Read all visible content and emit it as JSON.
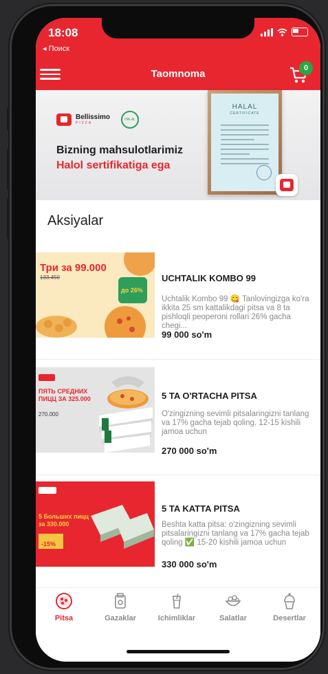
{
  "status_bar": {
    "time": "18:08",
    "back_label": "◂ Поиск"
  },
  "header": {
    "title": "Taomnoma",
    "cart_count": "0"
  },
  "banner": {
    "brand_name": "Bellissimo",
    "brand_sub": "PIZZA",
    "halal_badge": "HALAL",
    "line1": "Bizning mahsulotlarimiz",
    "line2": "Halol sertifikatiga ega",
    "certificate_title": "HALAL",
    "certificate_sub": "CERTIFICATE"
  },
  "section_title": "Aksiyalar",
  "promos": [
    {
      "name": "UCHTALIK KOMBO 99",
      "description": "Uchtalik Kombo 99 😋 Tanlovingizga ko'ra ikkita 25 sm kattalikdagi pitsa va 8 ta pishloqli peoperoni rollari 26% gacha chegi...",
      "price": "99 000 so'm",
      "image_text": "Три за 99.000",
      "image_old_price": "133.450",
      "image_badge": "до 26%"
    },
    {
      "name": "5 TA O'RTACHA PITSA",
      "description": "O'zingizning sevimli pitsalaringizni tanlang va 17% gacha tejab qoling. 12-15 kishili jamoa uchun",
      "price": "270 000 so'm",
      "image_text": "ПЯТЬ СРЕДНИХ ПИЦЦ ЗА 325.000",
      "image_old_price": "270.000"
    },
    {
      "name": "5 TA KATTA PITSA",
      "description": "Beshta katta pitsa: o'zingizning sevimli pitsalaringizni tanlang va 17% gacha tejab qoling ✅ 15-20 kishili jamoa uchun",
      "price": "330 000 so'm",
      "image_text": "5 Больших пицц за 330.000",
      "image_badge": "-15%"
    }
  ],
  "tabs": [
    {
      "label": "Pitsa",
      "icon": "pizza-icon",
      "active": true
    },
    {
      "label": "Gazaklar",
      "icon": "snack-icon",
      "active": false
    },
    {
      "label": "Ichimliklar",
      "icon": "drink-icon",
      "active": false
    },
    {
      "label": "Salatlar",
      "icon": "salad-icon",
      "active": false
    },
    {
      "label": "Desertlar",
      "icon": "dessert-icon",
      "active": false
    }
  ],
  "colors": {
    "brand_red": "#e8262f",
    "badge_green": "#27a844",
    "text_dark": "#1e1e1e",
    "text_grey": "#8a8a8a"
  }
}
